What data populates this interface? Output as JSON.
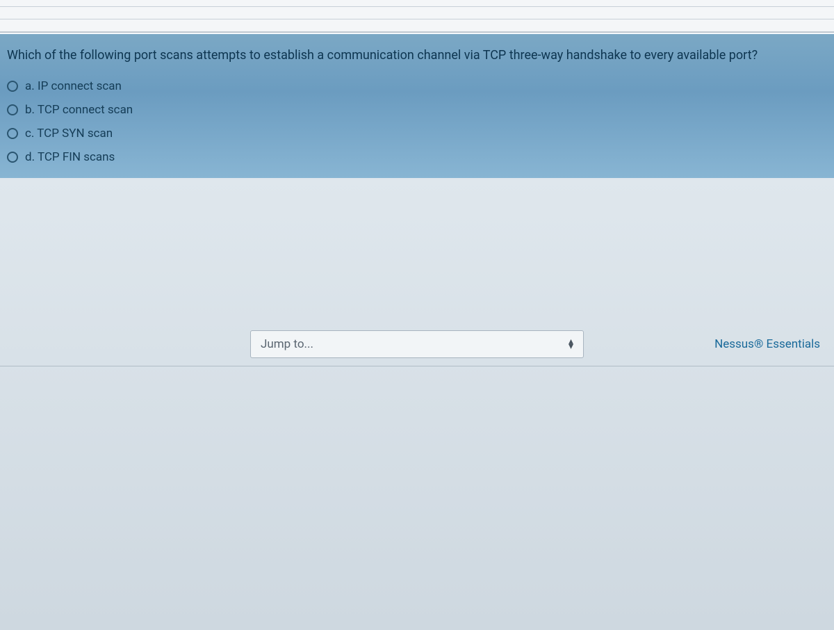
{
  "question": {
    "text": "Which of the following port scans attempts to establish a communication channel via TCP three-way handshake to every available port?",
    "options": [
      {
        "id": "a",
        "label": "a. IP connect scan"
      },
      {
        "id": "b",
        "label": "b. TCP connect scan"
      },
      {
        "id": "c",
        "label": "c. TCP SYN scan"
      },
      {
        "id": "d",
        "label": "d. TCP FIN scans"
      }
    ]
  },
  "nav": {
    "jump_placeholder": "Jump to...",
    "nessus_label": "Nessus® Essentials"
  }
}
